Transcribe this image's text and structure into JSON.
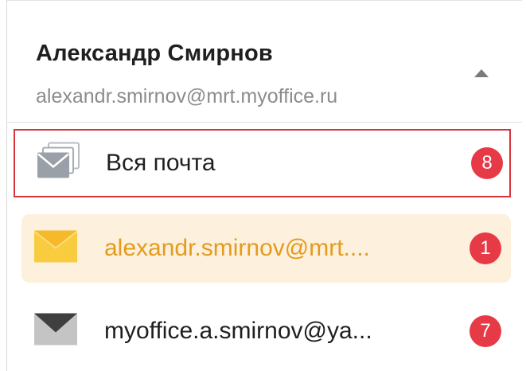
{
  "account": {
    "name": "Александр Смирнов",
    "email": "alexandr.smirnov@mrt.myoffice.ru"
  },
  "mailboxes": [
    {
      "label": "Вся почта",
      "count": "8",
      "icon": "stacked-envelopes-icon",
      "selected": false,
      "highlighted_outline": true
    },
    {
      "label": "alexandr.smirnov@mrt....",
      "count": "1",
      "icon": "yellow-envelope-icon",
      "selected": true
    },
    {
      "label": "myoffice.a.smirnov@ya...",
      "count": "7",
      "icon": "dark-envelope-icon",
      "selected": false
    }
  ],
  "colors": {
    "badge": "#e63a46",
    "selected_background": "#fdf0dc",
    "selected_text": "#e49b1d",
    "outline": "#d9343a"
  }
}
